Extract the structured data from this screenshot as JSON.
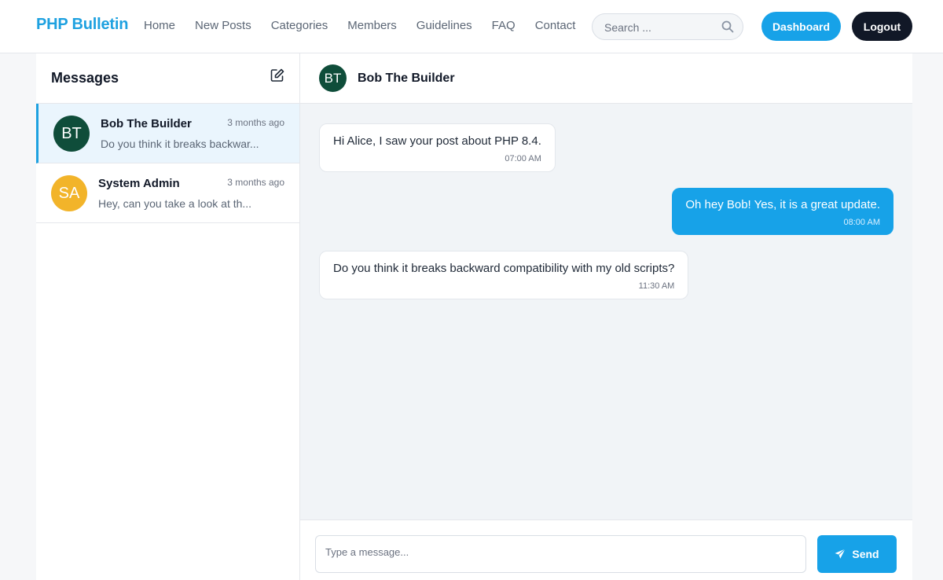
{
  "header": {
    "brand": "PHP Bulletin",
    "nav": [
      "Home",
      "New Posts",
      "Categories",
      "Members",
      "Guidelines",
      "FAQ",
      "Contact"
    ],
    "search_placeholder": "Search ...",
    "dashboard_label": "Dashboard",
    "logout_label": "Logout",
    "accent_color": "#17a2e8"
  },
  "sidebar": {
    "title": "Messages",
    "conversations": [
      {
        "initials": "BT",
        "name": "Bob The Builder",
        "time": "3 months ago",
        "snippet": "Do you think it breaks backwar...",
        "avatar_color": "#0f4d3a",
        "active": true
      },
      {
        "initials": "SA",
        "name": "System Admin",
        "time": "3 months ago",
        "snippet": "Hey, can you take a look at th...",
        "avatar_color": "#f2b42a",
        "active": false
      }
    ]
  },
  "chat": {
    "initials": "BT",
    "name": "Bob The Builder",
    "messages": [
      {
        "direction": "in",
        "text": "Hi Alice, I saw your post about PHP 8.4.",
        "time": "07:00 AM"
      },
      {
        "direction": "out",
        "text": "Oh hey Bob! Yes, it is a great update.",
        "time": "08:00 AM"
      },
      {
        "direction": "in",
        "text": "Do you think it breaks backward compatibility with my old scripts?",
        "time": "11:30 AM"
      }
    ],
    "composer": {
      "placeholder": "Type a message...",
      "send_label": "Send"
    }
  }
}
